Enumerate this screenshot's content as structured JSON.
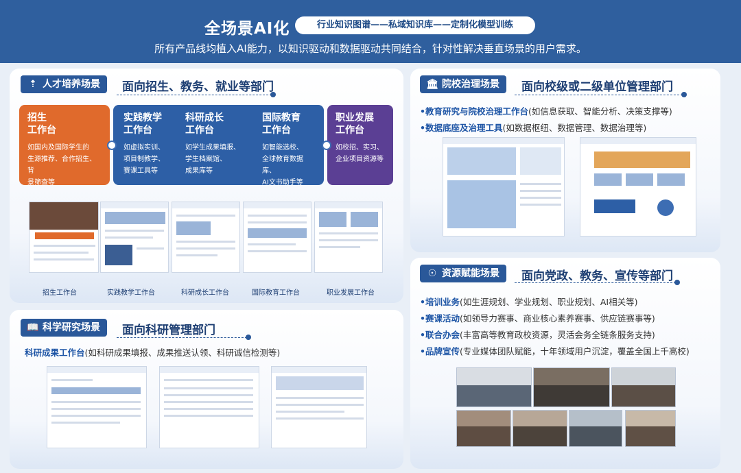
{
  "header": {
    "title": "全场景AI化",
    "pill": "行业知识图谱——私域知识库——定制化模型训练",
    "subtitle": "所有产品线均植入AI能力，以知识驱动和数据驱动共同结合，针对性解决垂直场景的用户需求。"
  },
  "talent": {
    "tag": "人才培养场景",
    "icon": "person-upload-icon",
    "dept": "面向招生、教务、就业等部门",
    "cards": [
      {
        "title": "招生\n工作台",
        "desc": "如国内及国际学生的\n生源推荐、合作招生、背\n景筛查等",
        "color": "#e06a2c"
      },
      {
        "title": "实践教学\n工作台",
        "desc": "如虚拟实训、\n项目制教学、\n赛课工具等",
        "color": "#2d5fa6"
      },
      {
        "title": "科研成长\n工作台",
        "desc": "如学生成果填报、\n学生档案馆、\n成果库等",
        "color": "#2d5fa6"
      },
      {
        "title": "国际教育\n工作台",
        "desc": "如智能选校、\n全球教育数据库、\nAI文书助手等",
        "color": "#2d5fa6"
      },
      {
        "title": "职业发展\n工作台",
        "desc": "如校招、实习、\n企业项目资源等",
        "color": "#5b3f94"
      }
    ],
    "captions": [
      "招生工作台",
      "实践教学工作台",
      "科研成长工作台",
      "国际教育工作台",
      "职业发展工作台"
    ]
  },
  "research": {
    "tag": "科学研究场景",
    "icon": "book-search-icon",
    "dept": "面向科研管理部门",
    "item_key": "科研成果工作台",
    "item_desc": "(如科研成果填报、成果推送认领、科研诚信检测等)"
  },
  "governance": {
    "tag": "院校治理场景",
    "icon": "institution-icon",
    "dept": "面向校级或二级单位管理部门",
    "items": [
      {
        "key": "•教育研究与院校治理工作台",
        "desc": "(如信息获取、智能分析、决策支撑等)"
      },
      {
        "key": "•数据底座及治理工具",
        "desc": "(如数据枢纽、数据管理、数据治理等)"
      }
    ]
  },
  "resources": {
    "tag": "资源赋能场景",
    "icon": "network-icon",
    "dept": "面向党政、教务、宣传等部门",
    "items": [
      {
        "key": "•培训业务",
        "desc": "(如生涯规划、学业规划、职业规划、AI相关等)"
      },
      {
        "key": "•赛课活动",
        "desc": "(如领导力赛事、商业核心素养赛事、供应链赛事等)"
      },
      {
        "key": "•联合办会",
        "desc": "(丰富高等教育政校资源，灵活会务全链条服务支持)"
      },
      {
        "key": "•品牌宣传",
        "desc": "(专业媒体团队赋能，十年领域用户沉淀，覆盖全国上千高校)"
      }
    ]
  }
}
